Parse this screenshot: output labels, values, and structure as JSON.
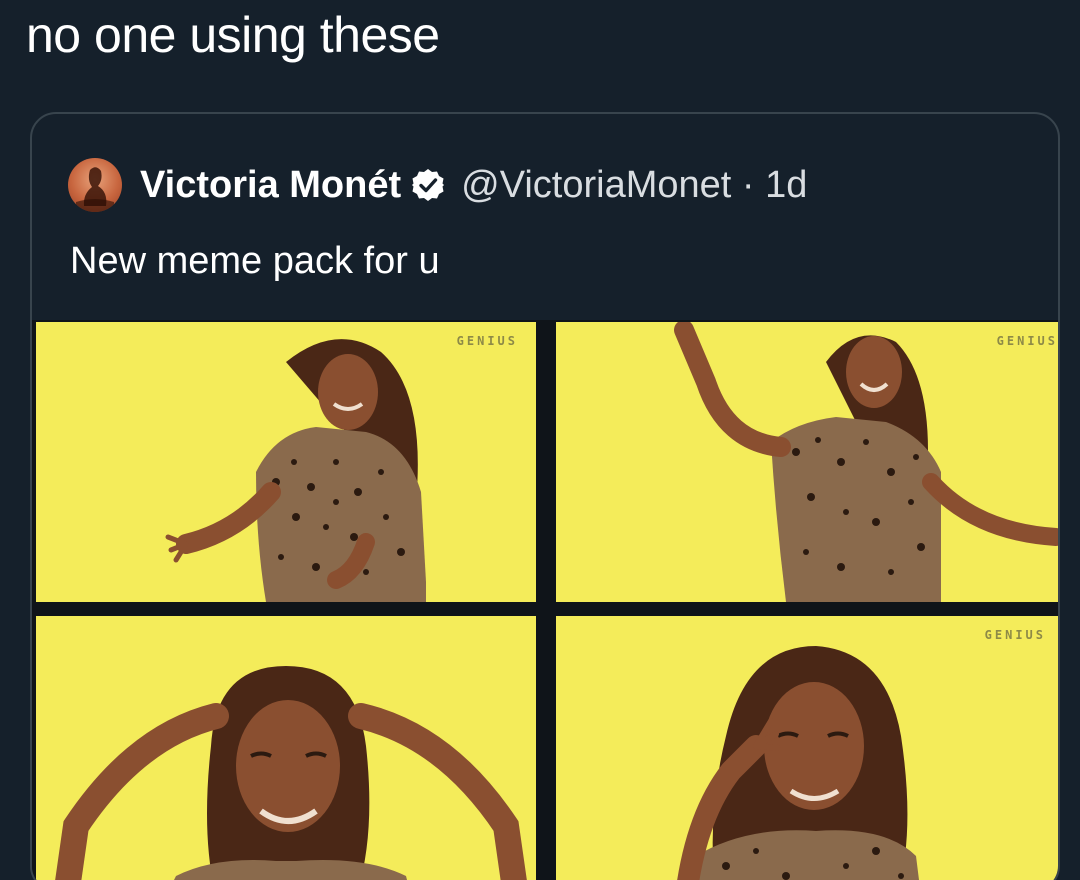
{
  "tweet": {
    "text": "no one using these"
  },
  "quote": {
    "display_name": "Victoria Monét",
    "verified": true,
    "handle_time": "@VictoriaMonet · 1d",
    "body": "New meme pack for u",
    "icons": {
      "avatar": "profile-avatar",
      "verified": "verified-badge-icon"
    },
    "media": [
      {
        "watermark": "GENIUS"
      },
      {
        "watermark": "GENIUS"
      },
      {
        "watermark": ""
      },
      {
        "watermark": "GENIUS"
      }
    ]
  },
  "colors": {
    "background": "#15202b",
    "card_border": "#38444d",
    "tile_background": "#f4ec5a",
    "text": "#ffffff"
  }
}
